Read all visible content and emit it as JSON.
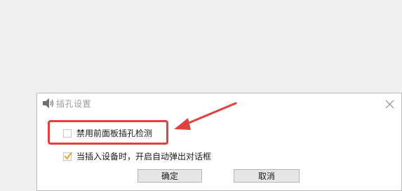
{
  "dialog": {
    "title": "插孔设置",
    "options": [
      {
        "label": "禁用前面板插孔检测",
        "checked": false
      },
      {
        "label": "当插入设备时，开启自动弹出对话框",
        "checked": true
      }
    ],
    "ok_label": "确定",
    "cancel_label": "取消"
  },
  "icons": {
    "title": "speaker-icon",
    "close": "close-icon",
    "check": "checkmark-icon"
  },
  "colors": {
    "highlight": "#e0403f",
    "checkmark": "#e8a33a"
  }
}
